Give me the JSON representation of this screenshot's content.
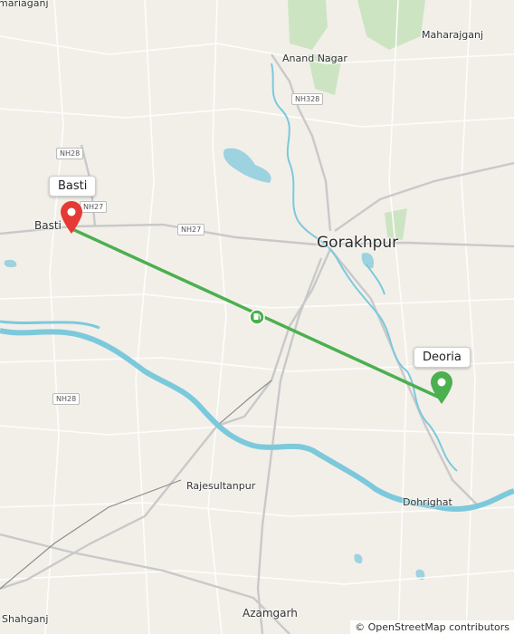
{
  "map": {
    "places": {
      "maharajganj_left": "mariaganj",
      "maharajganj": "Maharajganj",
      "anand_nagar": "Anand Nagar",
      "basti": "Basti",
      "gorakhpur": "Gorakhpur",
      "rajesultanpur": "Rajesultanpur",
      "dohrighat": "Dohrighat",
      "shahganj": "Shahganj",
      "azamgarh": "Azamgarh"
    },
    "roads": {
      "nh328": "NH328",
      "nh28_top": "NH28",
      "nh27_left": "NH27",
      "nh27_mid": "NH27",
      "nh28_bottom": "NH28"
    },
    "markers": {
      "start_popup": "Basti",
      "end_popup": "Deoria"
    },
    "route_color": "#4caf50",
    "start_marker_color": "#e53935",
    "end_marker_color": "#4caf50",
    "attribution": "© OpenStreetMap contributors",
    "icons": {
      "start": "map-pin-icon",
      "end": "map-pin-icon",
      "midpoint": "fuel-station-icon"
    }
  }
}
